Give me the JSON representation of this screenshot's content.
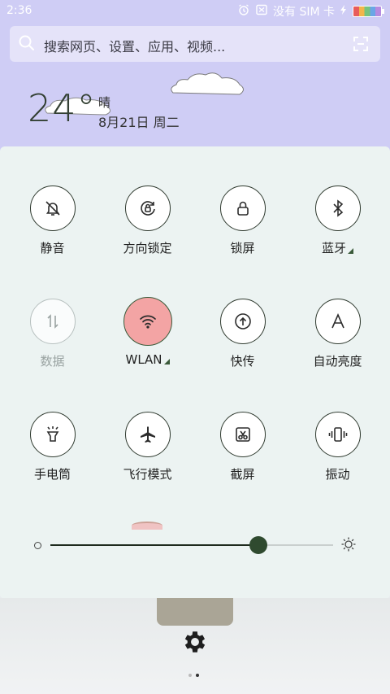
{
  "status_bar": {
    "time": "2:36",
    "carrier": "没有 SIM 卡",
    "icons": [
      "alarm-icon",
      "no-sim-icon",
      "charging-icon",
      "battery-icon"
    ]
  },
  "search": {
    "placeholder": "搜索网页、设置、应用、视频..."
  },
  "weather": {
    "temperature": "24°",
    "condition": "晴",
    "date": "8月21日 周二"
  },
  "toggles": [
    {
      "label": "静音",
      "icon": "bell-off-icon",
      "state": "off"
    },
    {
      "label": "方向锁定",
      "icon": "rotation-lock-icon",
      "state": "off"
    },
    {
      "label": "锁屏",
      "icon": "lock-icon",
      "state": "off"
    },
    {
      "label": "蓝牙",
      "icon": "bluetooth-icon",
      "state": "off",
      "has_more": true
    },
    {
      "label": "数据",
      "icon": "mobile-data-icon",
      "state": "disabled"
    },
    {
      "label": "WLAN",
      "icon": "wifi-icon",
      "state": "on",
      "has_more": true
    },
    {
      "label": "快传",
      "icon": "upload-icon",
      "state": "off"
    },
    {
      "label": "自动亮度",
      "icon": "auto-brightness-icon",
      "state": "off"
    },
    {
      "label": "手电筒",
      "icon": "flashlight-icon",
      "state": "off"
    },
    {
      "label": "飞行模式",
      "icon": "airplane-icon",
      "state": "off"
    },
    {
      "label": "截屏",
      "icon": "screenshot-icon",
      "state": "off"
    },
    {
      "label": "振动",
      "icon": "vibrate-icon",
      "state": "off"
    }
  ],
  "brightness": {
    "level": 0.735
  },
  "colors": {
    "accent": "#2f4a2f",
    "active_toggle": "#f3a4a4",
    "header_bg": "#cfcdf5"
  },
  "pager": {
    "pages": 2,
    "current": 1
  }
}
